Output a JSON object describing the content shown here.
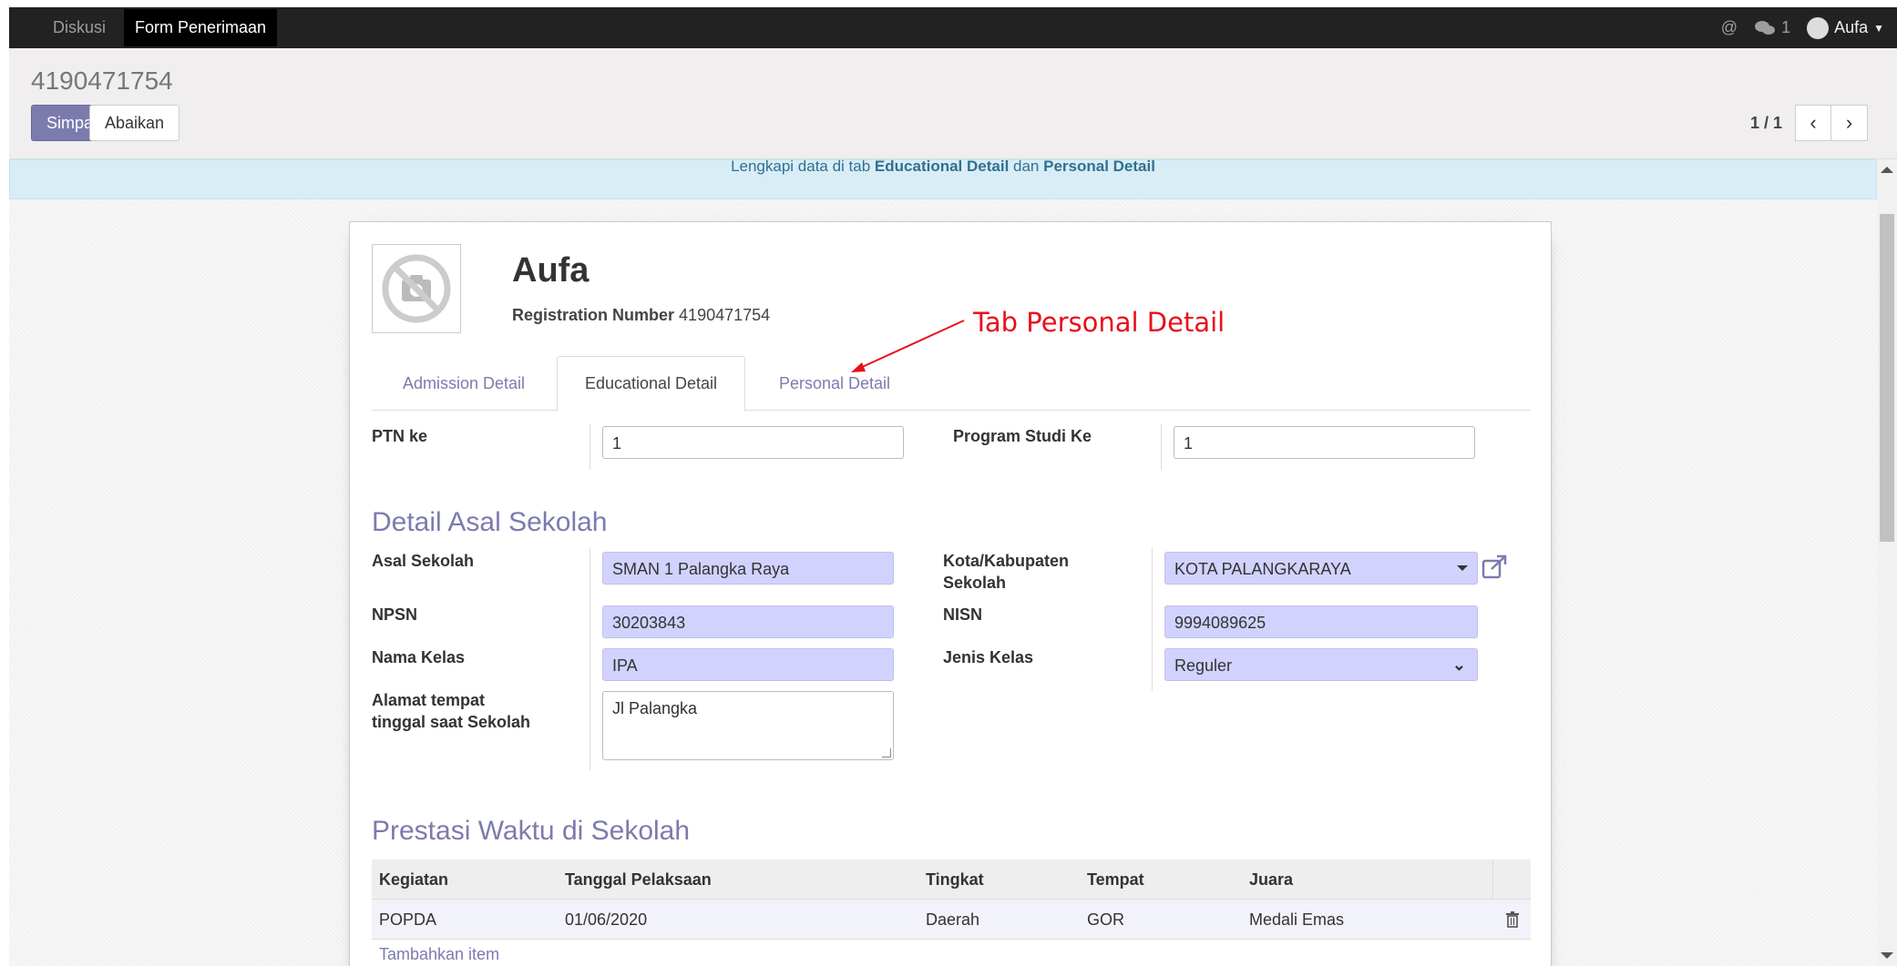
{
  "topbar": {
    "menu": [
      "Diskusi",
      "Form Penerimaan"
    ],
    "mention_glyph": "@",
    "messages_count": "1",
    "user": "Aufa"
  },
  "control": {
    "breadcrumb": "4190471754",
    "save_label": "Simpan",
    "discard_label": "Abaikan",
    "pager": "1 / 1"
  },
  "alert": {
    "text_before": "Lengkapi data di tab ",
    "tab1": "Educational Detail",
    "text_mid": " dan ",
    "tab2": "Personal Detail"
  },
  "record": {
    "name": "Aufa",
    "reg_label": "Registration Number",
    "reg_value": "4190471754"
  },
  "tabs": [
    "Admission Detail",
    "Educational Detail",
    "Personal Detail"
  ],
  "fields": {
    "ptn_label": "PTN ke",
    "ptn_value": "1",
    "prodi_label": "Program Studi Ke",
    "prodi_value": "1"
  },
  "school_section": {
    "title": "Detail Asal Sekolah",
    "asal_label": "Asal Sekolah",
    "asal_value": "SMAN 1 Palangka Raya",
    "kota_label_1": "Kota/Kabupaten",
    "kota_label_2": "Sekolah",
    "kota_value": "KOTA PALANGKARAYA",
    "npsn_label": "NPSN",
    "npsn_value": "30203843",
    "nisn_label": "NISN",
    "nisn_value": "9994089625",
    "kelas_label": "Nama Kelas",
    "kelas_value": "IPA",
    "jenis_label": "Jenis Kelas",
    "jenis_value": "Reguler",
    "alamat_label_1": "Alamat tempat",
    "alamat_label_2": "tinggal saat Sekolah",
    "alamat_value": "Jl Palangka"
  },
  "prestasi": {
    "title": "Prestasi Waktu di Sekolah",
    "columns": [
      "Kegiatan",
      "Tanggal Pelaksaan",
      "Tingkat",
      "Tempat",
      "Juara"
    ],
    "rows": [
      [
        "POPDA",
        "01/06/2020",
        "Daerah",
        "GOR",
        "Medali Emas"
      ]
    ],
    "add_item": "Tambahkan item"
  },
  "annotation": {
    "text": "Tab Personal Detail",
    "color": "#e8101a"
  }
}
